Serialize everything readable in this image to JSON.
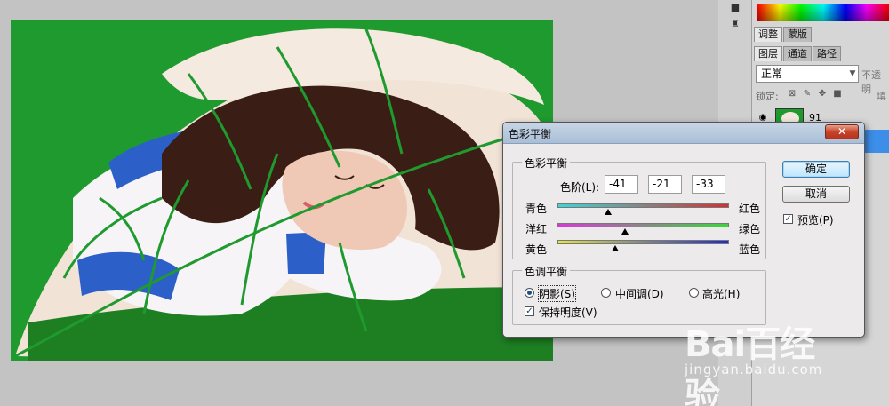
{
  "side_panel": {
    "tabs_top": [
      "调整",
      "蒙版"
    ],
    "tabs_layers": [
      "图层",
      "通道",
      "路径"
    ],
    "blend_mode": "正常",
    "opacity_label": "不透明",
    "lock_label": "锁定:",
    "fill_label": "填",
    "layer_name": "91"
  },
  "dialog": {
    "title": "色彩平衡",
    "close_glyph": "✕",
    "color_balance_group": "色彩平衡",
    "levels_label": "色阶(L):",
    "levels": [
      "-41",
      "-21",
      "-33"
    ],
    "sliders": [
      {
        "left": "青色",
        "right": "红色",
        "value": -41,
        "gradient": [
          "#3ad6d8",
          "#d43030"
        ]
      },
      {
        "left": "洋红",
        "right": "绿色",
        "value": -21,
        "gradient": [
          "#d63ad6",
          "#3ad63a"
        ]
      },
      {
        "left": "黄色",
        "right": "蓝色",
        "value": -33,
        "gradient": [
          "#e6e63a",
          "#1f2ad6"
        ]
      }
    ],
    "tone_group": "色调平衡",
    "tones": [
      "阴影(S)",
      "中间调(D)",
      "高光(H)"
    ],
    "selected_tone": "阴影(S)",
    "preserve_luminosity": "保持明度(V)",
    "ok": "确定",
    "cancel": "取消",
    "preview": "预览(P)"
  },
  "watermark": {
    "logo": "Bai百经验",
    "url": "jingyan.baidu.com"
  }
}
